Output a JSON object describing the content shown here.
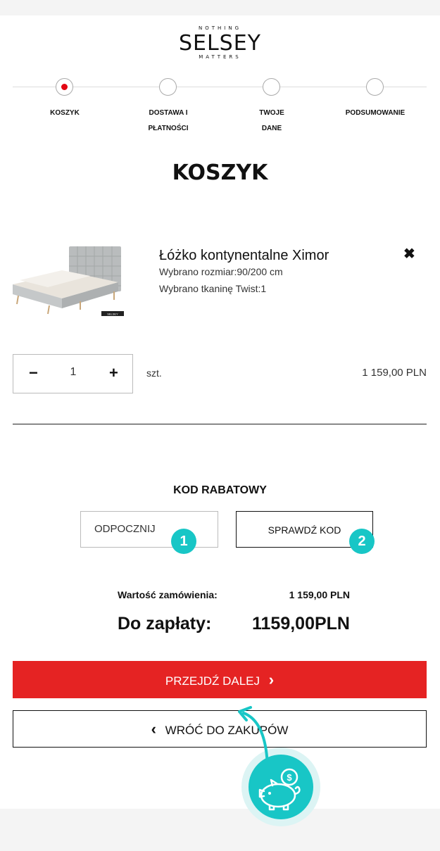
{
  "logo": {
    "top": "NOTHING",
    "main": "SELSEY",
    "bottom": "MATTERS"
  },
  "steps": [
    {
      "label": "KOSZYK",
      "active": true
    },
    {
      "label": "DOSTAWA I\nPŁATNOŚCI",
      "active": false
    },
    {
      "label": "TWOJE\nDANE",
      "active": false
    },
    {
      "label": "PODSUMOWANIE",
      "active": false
    }
  ],
  "page_title": "KOSZYK",
  "product": {
    "name": "Łóżko kontynentalne Ximor",
    "size_line": "Wybrano rozmiar:90/200 cm",
    "fabric_line": "Wybrano tkaninę Twist:1",
    "image_tag": "SELSEY",
    "remove_icon": "✖",
    "quantity": "1",
    "minus": "−",
    "plus": "+",
    "unit": "szt.",
    "price": "1 159,00 PLN"
  },
  "coupon": {
    "title": "KOD RABATOWY",
    "input_value": "ODPOCZNIJ",
    "button_label": "SPRAWDŹ KOD",
    "badge1": "1",
    "badge2": "2"
  },
  "summary": {
    "order_value_label": "Wartość zamówienia:",
    "order_value": "1 159,00 PLN",
    "to_pay_label": "Do zapłaty:",
    "to_pay_value": "1159,00PLN"
  },
  "actions": {
    "next_label": "PRZEJDŹ DALEJ",
    "next_icon": "›",
    "back_label": "WRÓĆ DO ZAKUPÓW",
    "back_icon": "‹"
  },
  "colors": {
    "accent_red": "#e52323",
    "badge_teal": "#18c6c6"
  },
  "icons": {
    "piggy": "piggy-bank-coin-icon",
    "arrow": "curved-arrow-icon"
  }
}
